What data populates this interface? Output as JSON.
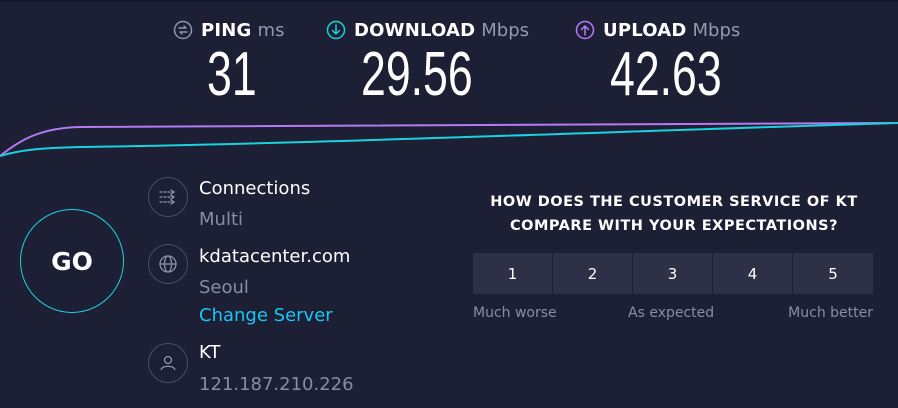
{
  "metrics": {
    "ping": {
      "name": "PING",
      "unit": "ms",
      "value": "31",
      "icon": "ping-icon",
      "color": "#9193a8"
    },
    "download": {
      "name": "DOWNLOAD",
      "unit": "Mbps",
      "value": "29.56",
      "icon": "download-icon",
      "color": "#1ad1de"
    },
    "upload": {
      "name": "UPLOAD",
      "unit": "Mbps",
      "value": "42.63",
      "icon": "upload-icon",
      "color": "#b57bf5"
    }
  },
  "graph": {
    "download_color": "#1ad1de",
    "upload_color": "#b57bf5"
  },
  "go_label": "GO",
  "connections": {
    "title": "Connections",
    "mode": "Multi",
    "icon": "connections-icon"
  },
  "server": {
    "host": "kdatacenter.com",
    "city": "Seoul",
    "change_label": "Change Server",
    "icon": "globe-icon"
  },
  "provider": {
    "name": "KT",
    "ip": "121.187.210.226",
    "icon": "user-icon"
  },
  "survey": {
    "question_line1": "HOW DOES THE CUSTOMER SERVICE OF KT",
    "question_line2": "COMPARE WITH YOUR EXPECTATIONS?",
    "options": [
      "1",
      "2",
      "3",
      "4",
      "5"
    ],
    "scale_low": "Much worse",
    "scale_mid": "As expected",
    "scale_high": "Much better"
  },
  "colors": {
    "background": "#1d1f34",
    "accent": "#1ac6f5",
    "button_bg": "#2e3047"
  }
}
